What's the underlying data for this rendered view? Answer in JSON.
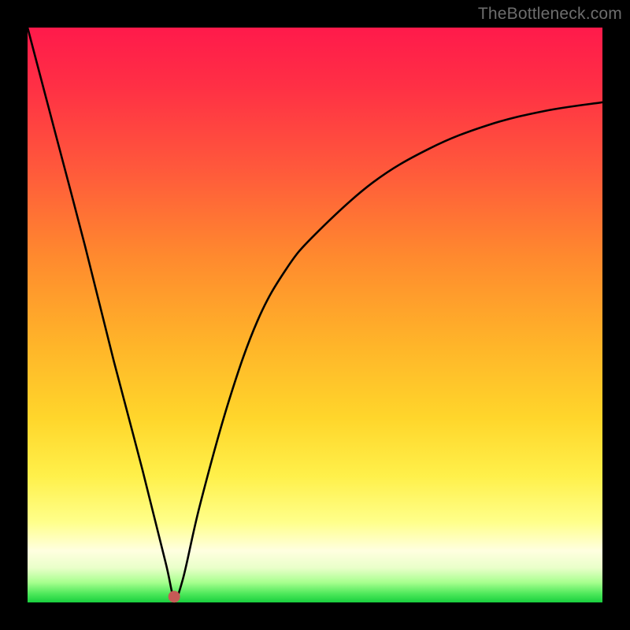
{
  "watermark": "TheBottleneck.com",
  "chart_data": {
    "type": "line",
    "title": "",
    "xlabel": "",
    "ylabel": "",
    "xlim": [
      0,
      100
    ],
    "ylim": [
      0,
      100
    ],
    "gradient_stops": [
      {
        "pos": 0,
        "color": "#ff1a4b"
      },
      {
        "pos": 10,
        "color": "#ff2f45"
      },
      {
        "pos": 25,
        "color": "#ff5a3b"
      },
      {
        "pos": 40,
        "color": "#ff8a2e"
      },
      {
        "pos": 55,
        "color": "#ffb429"
      },
      {
        "pos": 68,
        "color": "#ffd62b"
      },
      {
        "pos": 78,
        "color": "#fff04a"
      },
      {
        "pos": 86,
        "color": "#ffff8a"
      },
      {
        "pos": 91,
        "color": "#ffffe0"
      },
      {
        "pos": 94,
        "color": "#e9ffc9"
      },
      {
        "pos": 96.5,
        "color": "#a8ff8f"
      },
      {
        "pos": 98.5,
        "color": "#4de85a"
      },
      {
        "pos": 100,
        "color": "#19cf3e"
      }
    ],
    "series": [
      {
        "name": "bottleneck-curve",
        "x": [
          0,
          5,
          10,
          15,
          20,
          24,
          25.5,
          27,
          30,
          35,
          40,
          45,
          50,
          60,
          70,
          80,
          90,
          100
        ],
        "y": [
          100,
          81,
          62,
          42,
          23,
          7,
          1,
          4,
          17,
          35,
          49,
          58,
          64,
          73,
          79,
          83,
          85.5,
          87
        ]
      }
    ],
    "marker": {
      "x": 25.5,
      "y": 1,
      "color": "#c65a56",
      "radius_px": 7
    }
  }
}
